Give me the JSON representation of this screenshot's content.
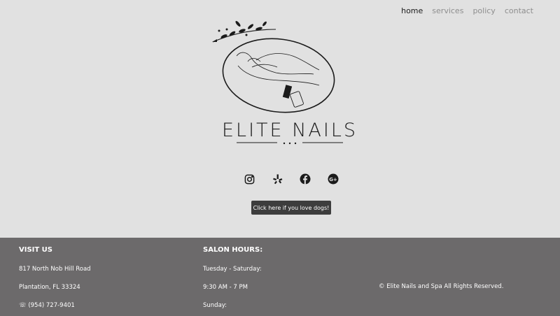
{
  "nav": {
    "items": [
      {
        "label": "home"
      },
      {
        "label": "services"
      },
      {
        "label": "policy"
      },
      {
        "label": "contact"
      }
    ]
  },
  "brand": {
    "name": "ELITE NAILS"
  },
  "social": [
    "instagram-icon",
    "yelp-icon",
    "facebook-icon",
    "google-plus-icon"
  ],
  "dogs_button": {
    "label": "Click here if you love dogs!"
  },
  "footer": {
    "visit": {
      "heading": "VISIT US",
      "address1": "817 North Nob Hill Road",
      "address2": "Plantation, FL 33324",
      "phone": "☏ (954) 727-9401"
    },
    "hours": {
      "heading": "SALON HOURS:",
      "line1": "Tuesday - Saturday:",
      "line2": "9:30 AM - 7 PM",
      "line3": "Sunday:"
    },
    "copyright": "© Elite Nails and Spa All Rights Reserved."
  },
  "colors": {
    "page_bg": "#e1e1e1",
    "footer_bg": "#6c6a6b",
    "button_bg": "#3d3d3d"
  }
}
